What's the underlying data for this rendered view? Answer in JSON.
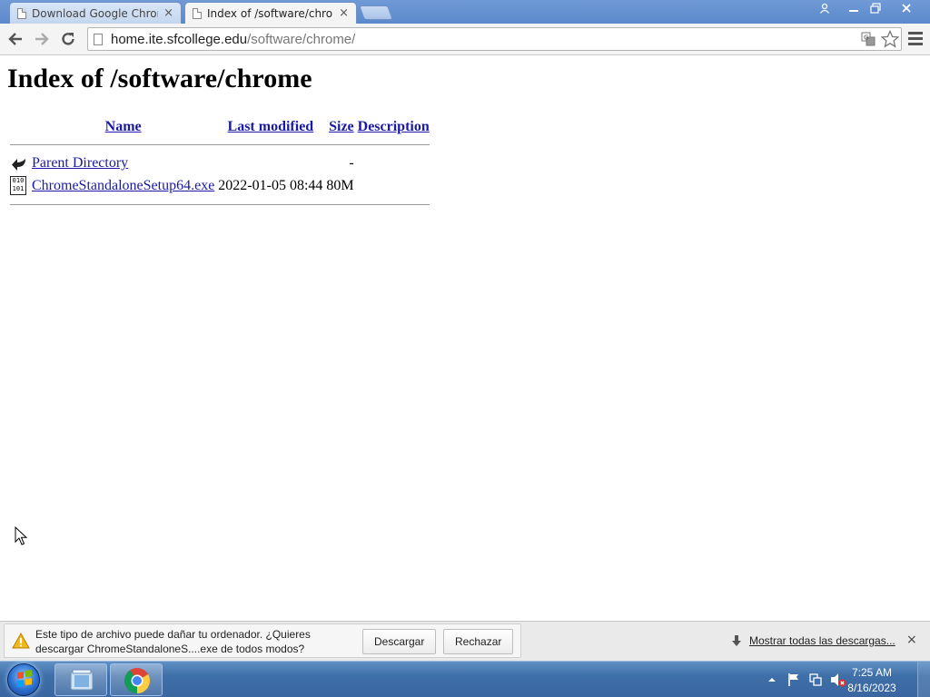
{
  "browser": {
    "tabs": [
      {
        "title": "Download Google Chrome",
        "close": "×",
        "active": false
      },
      {
        "title": "Index of /software/chrome",
        "close": "×",
        "active": true
      }
    ],
    "url_host": "home.ite.sfcollege.edu",
    "url_path": "/software/chrome/",
    "icons": {
      "back": "arrow-left-icon",
      "forward": "arrow-right-icon",
      "reload": "reload-icon",
      "translate": "translate-icon",
      "bookmark": "star-icon",
      "menu": "hamburger-menu-icon"
    }
  },
  "page": {
    "heading": "Index of /software/chrome",
    "columns": [
      "Name",
      "Last modified",
      "Size",
      "Description"
    ],
    "rows": [
      {
        "icon": "back-arrow-icon",
        "name": "Parent Directory",
        "modified": "",
        "size": "-",
        "description": ""
      },
      {
        "icon": "binary-file-icon",
        "name": "ChromeStandaloneSetup64.exe",
        "modified": "2022-01-05 08:44",
        "size": "80M",
        "description": ""
      }
    ]
  },
  "download_bar": {
    "warning_line1": "Este tipo de archivo puede dañar tu ordenador. ¿Quieres",
    "warning_line2": "descargar ChromeStandaloneS....exe de todos modos?",
    "keep_button": "Descargar",
    "discard_button": "Rechazar",
    "show_all": "Mostrar todas las descargas...",
    "close": "×"
  },
  "taskbar": {
    "time": "7:25 AM",
    "date": "8/16/2023"
  },
  "colors": {
    "link": "#1a1aa6",
    "taskbar": "#3f6fa8",
    "titlebar": "#5b89cc"
  }
}
